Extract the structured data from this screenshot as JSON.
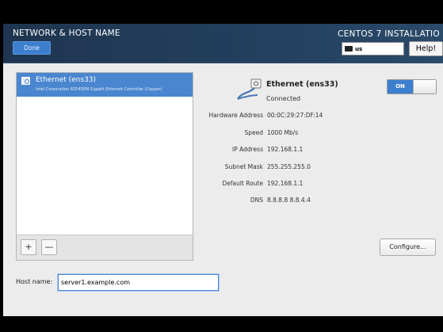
{
  "header": {
    "title": "NETWORK & HOST NAME",
    "done_label": "Done",
    "install_title": "CENTOS 7 INSTALLATIO",
    "keyboard_layout": "us",
    "help_label": "Help!"
  },
  "devices": [
    {
      "name": "Ethernet (ens33)",
      "description": "Intel Corporation 82545EM Gigabit Ethernet Controller (Copper)"
    }
  ],
  "list_toolbar": {
    "add_label": "+",
    "remove_label": "—"
  },
  "detail": {
    "name": "Ethernet (ens33)",
    "status": "Connected",
    "toggle_label": "ON",
    "toggle_on": true,
    "rows": [
      {
        "label": "Hardware Address",
        "value": "00:0C:29:27:DF:14"
      },
      {
        "label": "Speed",
        "value": "1000 Mb/s"
      },
      {
        "label": "IP Address",
        "value": "192.168.1.1"
      },
      {
        "label": "Subnet Mask",
        "value": "255.255.255.0"
      },
      {
        "label": "Default Route",
        "value": "192.168.1.1"
      },
      {
        "label": "DNS",
        "value": "8.8.8.8 8.8.4.4"
      }
    ],
    "configure_label": "Configure..."
  },
  "hostname": {
    "label": "Host name:",
    "value": "server1.example.com"
  },
  "colors": {
    "header_bg": "#23405e",
    "accent_blue": "#3d7fcf",
    "selection_blue": "#4a86cf",
    "panel_bg": "#ececec"
  }
}
